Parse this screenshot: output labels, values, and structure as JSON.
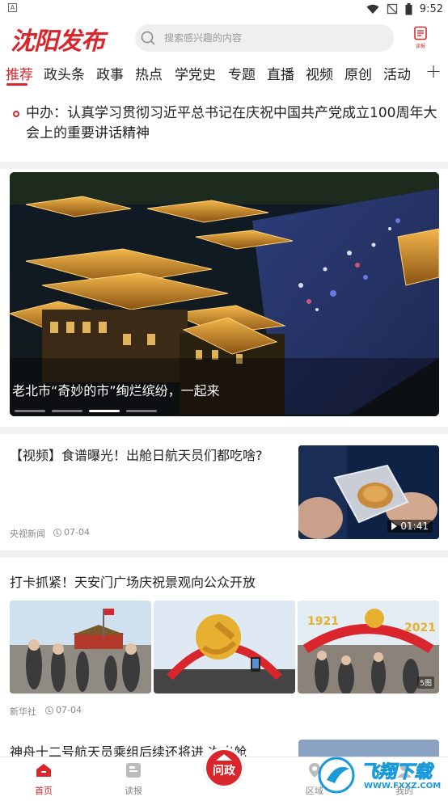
{
  "status_bar": {
    "time": "9:52",
    "app_badge": "A"
  },
  "header": {
    "logo": "沈阳发布",
    "search_placeholder": "搜索感兴趣的内容",
    "reader_label": "读报"
  },
  "tabs": [
    "推荐",
    "政头条",
    "政事",
    "热点",
    "学党史",
    "专题",
    "直播",
    "视频",
    "原创",
    "活动"
  ],
  "active_tab": "推荐",
  "headline": {
    "text": "中办：认真学习贯彻习近平总书记在庆祝中国共产党成立100周年大会上的重要讲话精神"
  },
  "carousel": {
    "caption": "老北市“奇妙的市”绚烂缤纷，一起来",
    "slide_count": 4,
    "active_slide": 3
  },
  "news": [
    {
      "title": "【视频】食谱曝光！出舱日航天员们都吃啥?",
      "source": "央视新闻",
      "date": "07-04",
      "duration": "01:41"
    },
    {
      "title": "打卡抓紧！天安门广场庆祝景观向公众开放",
      "source": "新华社",
      "date": "07-04",
      "photo_count": "5图",
      "banner_years": [
        "1921",
        "2021"
      ]
    },
    {
      "title": "神舟十二号航天员乘组后续还将进    次出舱"
    }
  ],
  "bottom_nav": {
    "home": "首页",
    "newspaper": "读报",
    "center": "问政",
    "district": "区域",
    "mine": "我的"
  },
  "watermark": {
    "text": "飞翔下载",
    "url": "WWW.FXXZ.COM"
  },
  "colors": {
    "brand_red": "#d8262c",
    "divider": "#f1f1f1"
  }
}
